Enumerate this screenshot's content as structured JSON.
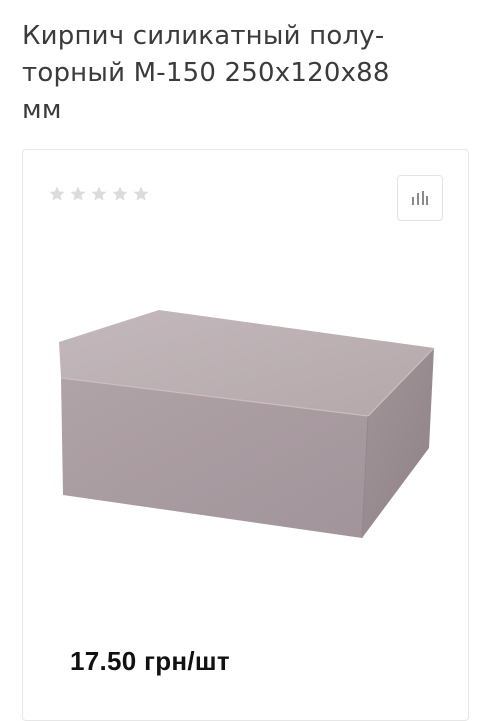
{
  "product": {
    "title": "Кирпич силикатный полу-торный М-150 250х120х88 мм",
    "title_lines": [
      "Кирпич силикатный полу-",
      "торный М-150 250х120х88",
      "мм"
    ],
    "rating": 0,
    "rating_max": 5,
    "price": "17.50 грн/шт",
    "image_icon": "brick-image"
  },
  "controls": {
    "compare_icon": "bar-chart-icon"
  },
  "colors": {
    "star_empty": "#dcdcdc",
    "icon": "#8a8a8a",
    "brick_top": "#b9adb0",
    "brick_front": "#a89a9e",
    "brick_side": "#998b8f"
  }
}
